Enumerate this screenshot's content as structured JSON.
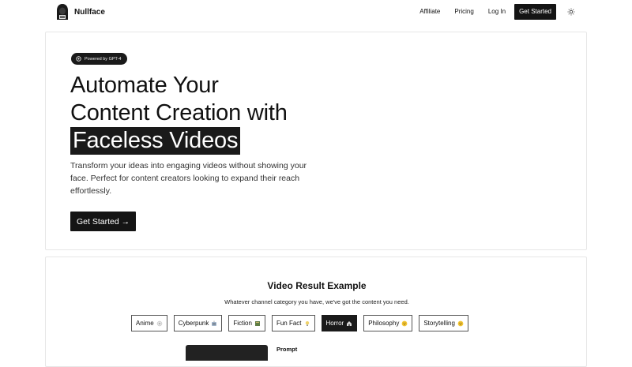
{
  "header": {
    "brand": "Nullface",
    "nav": {
      "affiliate": "Affiliate",
      "pricing": "Pricing",
      "login": "Log In",
      "get_started": "Get Started"
    }
  },
  "hero": {
    "badge": "Powered by GPT-4",
    "title_line1": "Automate Your",
    "title_line2": "Content Creation with",
    "title_highlight": "Faceless Videos",
    "description": "Transform your ideas into engaging videos without showing your face. Perfect for content creators looking to expand their reach effortlessly.",
    "cta": "Get Started →"
  },
  "examples": {
    "title": "Video Result Example",
    "subtitle": "Whatever channel category you have, we've got the content you need.",
    "categories": [
      {
        "label": "Anime",
        "icon": "sparkle-icon",
        "color": "#cfcfcf"
      },
      {
        "label": "Cyberpunk",
        "icon": "robot-icon",
        "color": "#8aa0b8"
      },
      {
        "label": "Fiction",
        "icon": "book-icon",
        "color": "#6b8a4a"
      },
      {
        "label": "Fun Fact",
        "icon": "lightbulb-icon",
        "color": "#e3c25a"
      },
      {
        "label": "Horror",
        "icon": "haunted-house-icon",
        "color": "#d9d9d9"
      },
      {
        "label": "Philosophy",
        "icon": "thinking-face-icon",
        "color": "#f2c533"
      },
      {
        "label": "Storytelling",
        "icon": "smile-face-icon",
        "color": "#f2c533"
      }
    ],
    "active_category": "Horror",
    "prompt_label": "Prompt"
  },
  "colors": {
    "dark": "#141414",
    "border": "#e7e7e7"
  }
}
